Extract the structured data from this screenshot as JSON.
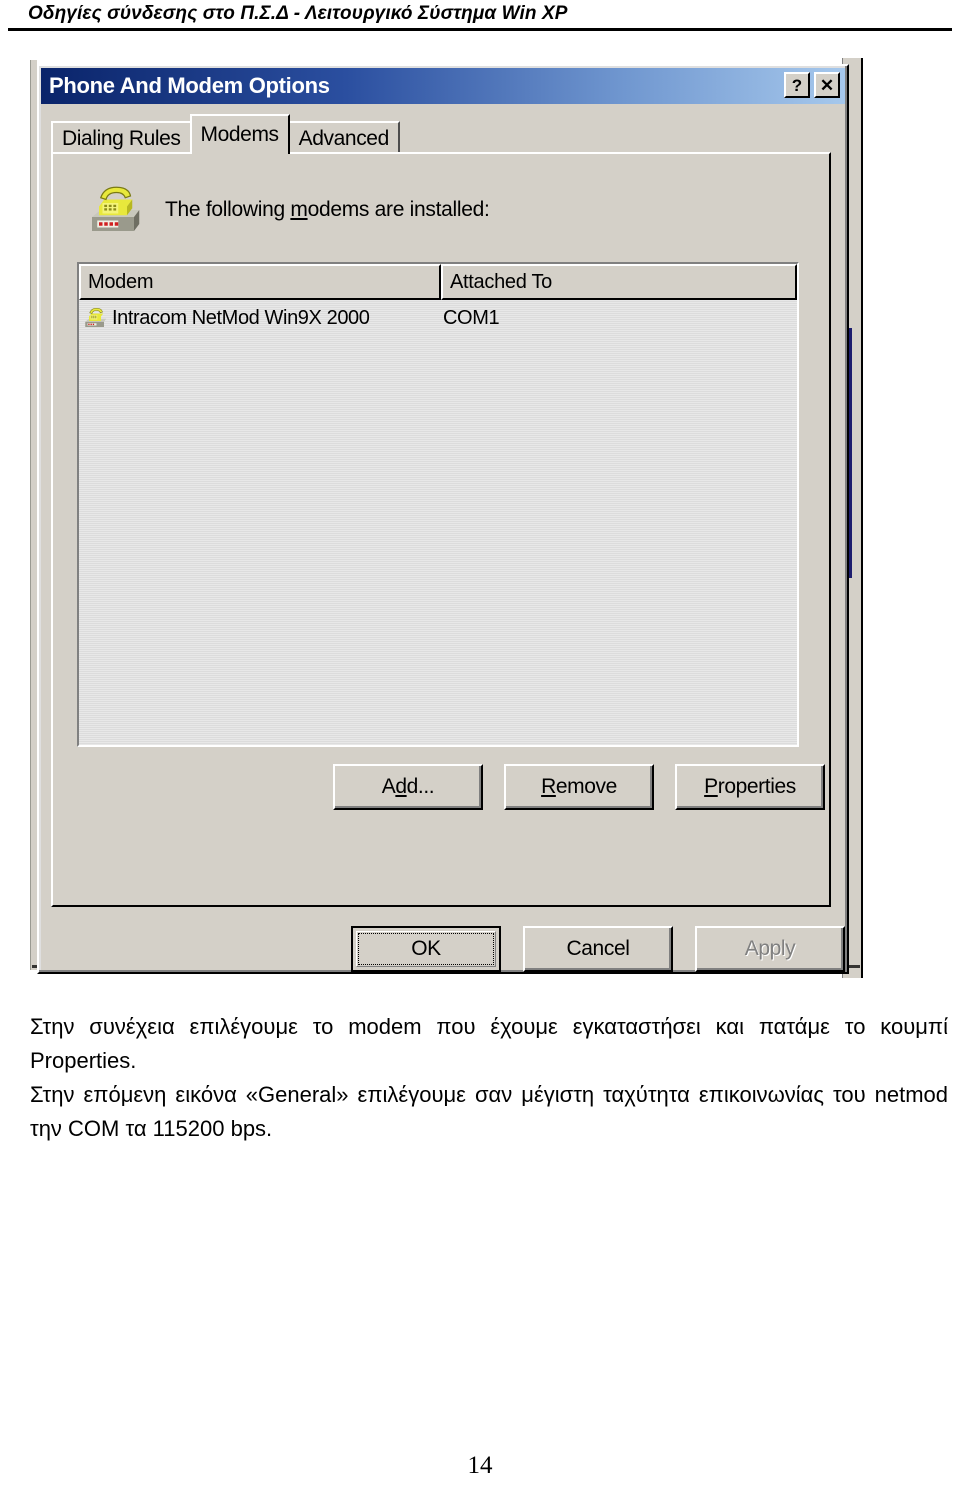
{
  "document": {
    "header_title": "Οδηγίες σύνδεσης στο Π.Σ.Δ - Λειτουργικό Σύστημα Win XP",
    "page_number": "14"
  },
  "dialog": {
    "title": "Phone And Modem Options",
    "titlebar_buttons": [
      {
        "name": "help-button",
        "label": "?"
      },
      {
        "name": "close-button",
        "label": "✕"
      }
    ],
    "tabs": [
      {
        "label": "Dialing Rules",
        "selected": false
      },
      {
        "label": "Modems",
        "selected": true
      },
      {
        "label": "Advanced",
        "selected": false
      }
    ],
    "prompt_before": "The following ",
    "prompt_accel": "m",
    "prompt_after": "odems are  installed:",
    "prompt_full": "The following modems are  installed:",
    "icon_name": "modem-telephone-icon",
    "listview": {
      "columns": [
        {
          "label": "Modem"
        },
        {
          "label": "Attached To"
        }
      ],
      "rows": [
        {
          "modem": "Intracom NetMod Win9X 2000",
          "attached_to": "COM1",
          "icon": "modem-small-icon"
        }
      ]
    },
    "action_buttons": [
      {
        "name": "add-button",
        "pre": "A",
        "accel": "d",
        "post": "d...",
        "label": "Add...",
        "disabled": false
      },
      {
        "name": "remove-button",
        "pre": "",
        "accel": "R",
        "post": "emove",
        "label": "Remove",
        "disabled": false
      },
      {
        "name": "properties-button",
        "pre": "",
        "accel": "P",
        "post": "roperties",
        "label": "Properties",
        "disabled": false
      }
    ],
    "footer_buttons": [
      {
        "name": "ok-button",
        "label": "OK",
        "default": true,
        "disabled": false
      },
      {
        "name": "cancel-button",
        "label": "Cancel",
        "default": false,
        "disabled": false
      },
      {
        "name": "apply-button",
        "label": "Apply",
        "default": false,
        "disabled": true
      }
    ],
    "colors": {
      "titlebar_start": "#0a246a",
      "titlebar_end": "#a6c8ec",
      "face": "#d4d0c8",
      "list_face": "#dcdcdc",
      "disabled_text": "#808080"
    }
  },
  "body": {
    "paragraph_1": "Στην συνέχεια επιλέγουμε το modem που έχουμε εγκαταστήσει και πατάμε το κουμπί Properties.",
    "paragraph_2": "Στην επόμενη εικόνα «General» επιλέγουμε σαν μέγιστη ταχύτητα επικοινωνίας του netmod την COM τα 115200 bps."
  }
}
